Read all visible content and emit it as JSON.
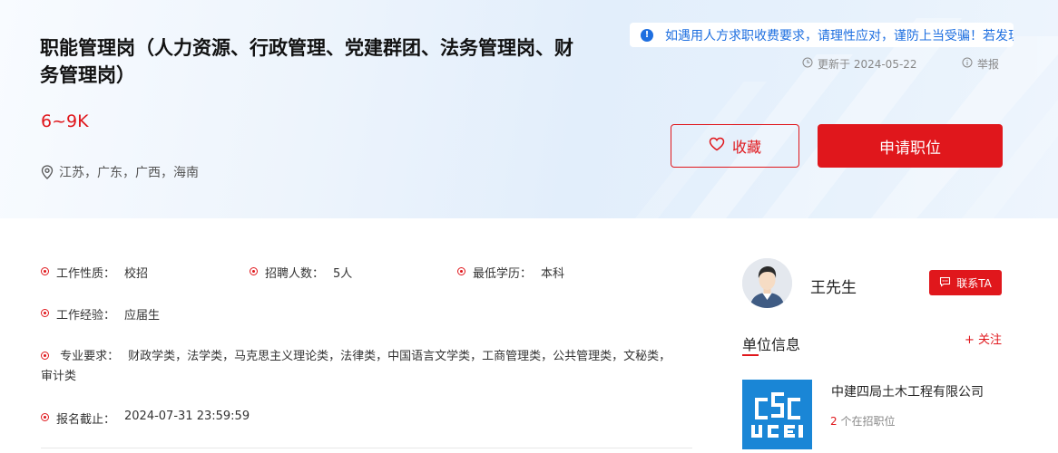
{
  "job": {
    "title": "职能管理岗（人力资源、行政管理、党建群团、法务管理岗、财务管理岗）",
    "salary": "6~9K",
    "location": "江苏，广东，广西，海南"
  },
  "notice": {
    "text": "如遇用人方求职收费要求，请理性应对，谨防上当受骗！若发现虚假信息，请及时举报",
    "icon": "info-icon"
  },
  "meta": {
    "updated": "更新于 2024-05-22",
    "report": "举报"
  },
  "actions": {
    "favorite": "收藏",
    "apply": "申请职位"
  },
  "details": {
    "nature": {
      "label": "工作性质：",
      "value": "校招"
    },
    "headcount": {
      "label": "招聘人数：",
      "value": "5人"
    },
    "education": {
      "label": "最低学历：",
      "value": "本科"
    },
    "experience": {
      "label": "工作经验：",
      "value": "应届生"
    },
    "major": {
      "label": "专业要求：",
      "value": "财政学类，法学类，马克思主义理论类，法律类，中国语言文学类，工商管理类，公共管理类，文秘类，审计类"
    },
    "deadline": {
      "label": "报名截止：",
      "value": "2024-07-31 23:59:59"
    }
  },
  "recruiter": {
    "name": "王先生",
    "contact_label": "联系TA"
  },
  "company": {
    "section_title": "单位信息",
    "follow_label": "+ 关注",
    "name": "中建四局土木工程有限公司",
    "job_count": "2",
    "job_count_suffix": " 个在招职位"
  },
  "colors": {
    "accent": "#e0171c",
    "notice_blue": "#1e6fe0",
    "logo_blue": "#1a86d6"
  }
}
